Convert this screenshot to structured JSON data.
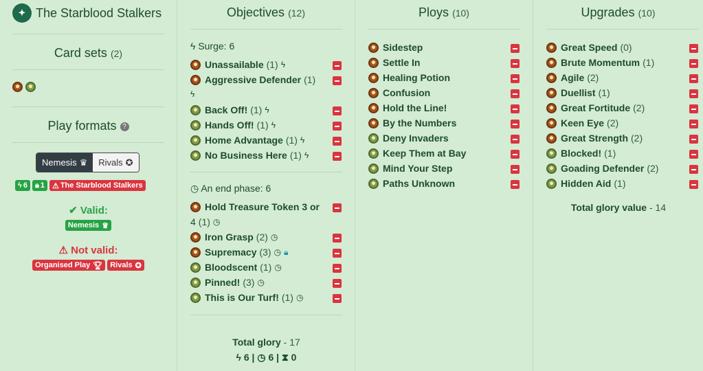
{
  "warband": {
    "name": "The Starblood Stalkers",
    "logo_icon": "warband-emblem-icon"
  },
  "card_sets": {
    "title": "Card sets",
    "count": "(2)",
    "icons": [
      "orange",
      "green"
    ]
  },
  "play_formats": {
    "title": "Play formats",
    "help_icon": "question-circle-icon",
    "options": [
      {
        "label": "Nemesis",
        "icon": "crown-icon",
        "active": true
      },
      {
        "label": "Rivals",
        "icon": "medal-icon",
        "active": false
      }
    ],
    "stats": {
      "surge": "6",
      "restricted": "1",
      "warning": "The Starblood Stalkers"
    },
    "valid_label": "Valid:",
    "valid_formats": [
      "Nemesis"
    ],
    "not_valid_label": "Not valid:",
    "not_valid_formats": [
      "Organised Play",
      "Rivals"
    ]
  },
  "objectives": {
    "title": "Objectives",
    "count": "(12)",
    "surge_head": "Surge: 6",
    "surge_items": [
      {
        "name": "Unassailable",
        "count": "(1)",
        "icon": "orange"
      },
      {
        "name": "Aggressive Defender",
        "count": "(1)",
        "icon": "orange"
      },
      {
        "name": "Back Off!",
        "count": "(1)",
        "icon": "green"
      },
      {
        "name": "Hands Off!",
        "count": "(1)",
        "icon": "green"
      },
      {
        "name": "Home Advantage",
        "count": "(1)",
        "icon": "green"
      },
      {
        "name": "No Business Here",
        "count": "(1)",
        "icon": "green"
      }
    ],
    "end_head": "An end phase: 6",
    "end_items": [
      {
        "name": "Hold Treasure Token 3 or",
        "count": "",
        "icon": "orange"
      },
      {
        "name": "4",
        "count": "(1)",
        "icon": "none"
      },
      {
        "name": "Iron Grasp",
        "count": "(2)",
        "icon": "orange"
      },
      {
        "name": "Supremacy",
        "count": "(3)",
        "icon": "orange"
      },
      {
        "name": "Bloodscent",
        "count": "(1)",
        "icon": "green"
      },
      {
        "name": "Pinned!",
        "count": "(3)",
        "icon": "green"
      },
      {
        "name": "This is Our Turf!",
        "count": "(1)",
        "icon": "green"
      }
    ],
    "total_label": "Total glory",
    "total_value": "- 17",
    "totals": {
      "surge": "6",
      "end": "6",
      "third": "0"
    }
  },
  "ploys": {
    "title": "Ploys",
    "count": "(10)",
    "items": [
      {
        "name": "Sidestep",
        "icon": "orange"
      },
      {
        "name": "Settle In",
        "icon": "orange"
      },
      {
        "name": "Healing Potion",
        "icon": "orange"
      },
      {
        "name": "Confusion",
        "icon": "orange"
      },
      {
        "name": "Hold the Line!",
        "icon": "orange"
      },
      {
        "name": "By the Numbers",
        "icon": "orange"
      },
      {
        "name": "Deny Invaders",
        "icon": "green"
      },
      {
        "name": "Keep Them at Bay",
        "icon": "green"
      },
      {
        "name": "Mind Your Step",
        "icon": "green"
      },
      {
        "name": "Paths Unknown",
        "icon": "green"
      }
    ]
  },
  "upgrades": {
    "title": "Upgrades",
    "count": "(10)",
    "items": [
      {
        "name": "Great Speed",
        "count": "(0)",
        "icon": "orange"
      },
      {
        "name": "Brute Momentum",
        "count": "(1)",
        "icon": "orange"
      },
      {
        "name": "Agile",
        "count": "(2)",
        "icon": "orange"
      },
      {
        "name": "Duellist",
        "count": "(1)",
        "icon": "orange"
      },
      {
        "name": "Great Fortitude",
        "count": "(2)",
        "icon": "orange"
      },
      {
        "name": "Keen Eye",
        "count": "(2)",
        "icon": "orange"
      },
      {
        "name": "Great Strength",
        "count": "(2)",
        "icon": "orange"
      },
      {
        "name": "Blocked!",
        "count": "(1)",
        "icon": "green"
      },
      {
        "name": "Goading Defender",
        "count": "(2)",
        "icon": "green"
      },
      {
        "name": "Hidden Aid",
        "count": "(1)",
        "icon": "green"
      }
    ],
    "total_label": "Total glory value",
    "total_value": "- 14"
  },
  "colors": {
    "background": "#d4ebd4",
    "text": "#1d4d2a",
    "remove": "#d9353f",
    "valid": "#27a344"
  }
}
